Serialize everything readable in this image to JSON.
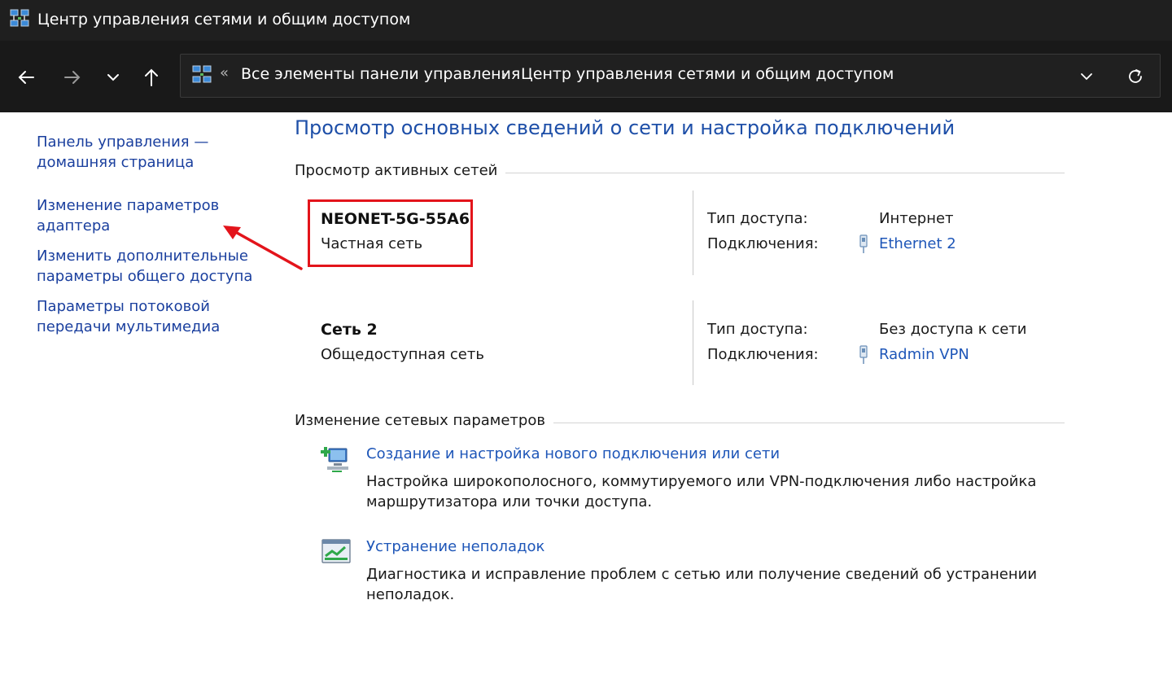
{
  "window": {
    "title": "Центр управления сетями и общим доступом",
    "app_icon": "network-center-icon"
  },
  "nav": {
    "back_icon": "back-arrow-icon",
    "forward_icon": "forward-arrow-icon",
    "recent_icon": "chevron-down-icon",
    "up_icon": "up-arrow-icon"
  },
  "address": {
    "overflow_glyph": "«",
    "crumbs": [
      "Все элементы панели управления",
      "Центр управления сетями и общим доступом"
    ],
    "separator": "›",
    "dropdown_icon": "chevron-down-icon",
    "refresh_icon": "refresh-icon"
  },
  "sidebar": {
    "items": [
      {
        "label_line1": "Панель управления —",
        "label_line2": "домашняя страница"
      },
      {
        "label_line1": "Изменение параметров",
        "label_line2": "адаптера"
      },
      {
        "label_line1": "Изменить дополнительные",
        "label_line2": "параметры общего доступа"
      },
      {
        "label_line1": "Параметры потоковой",
        "label_line2": "передачи мультимедиа"
      }
    ]
  },
  "main": {
    "heading": "Просмотр основных сведений о сети и настройка подключений",
    "active_networks_label": "Просмотр активных сетей",
    "access_type_label": "Тип доступа:",
    "connections_label": "Подключения:",
    "networks": [
      {
        "name": "NEONET-5G-55A6",
        "type": "Частная сеть",
        "access": "Интернет",
        "connection": "Ethernet 2"
      },
      {
        "name": "Сеть 2",
        "type": "Общедоступная сеть",
        "access": "Без доступа к сети",
        "connection": "Radmin VPN"
      }
    ],
    "change_settings_label": "Изменение сетевых параметров",
    "tasks": [
      {
        "icon": "new-connection-icon",
        "title": "Создание и настройка нового подключения или сети",
        "desc_line1": "Настройка широкополосного, коммутируемого или VPN-подключения либо настройка",
        "desc_line2": "маршрутизатора или точки доступа."
      },
      {
        "icon": "troubleshoot-icon",
        "title": "Устранение неполадок",
        "desc_line1": "Диагностика и исправление проблем с сетью или получение сведений об устранении",
        "desc_line2": "неполадок."
      }
    ]
  },
  "annotation": {
    "highlight_color": "#e3141b"
  },
  "colors": {
    "link": "#1e56b8",
    "heading": "#1e4fa8",
    "titlebar": "#1f1f1f"
  }
}
